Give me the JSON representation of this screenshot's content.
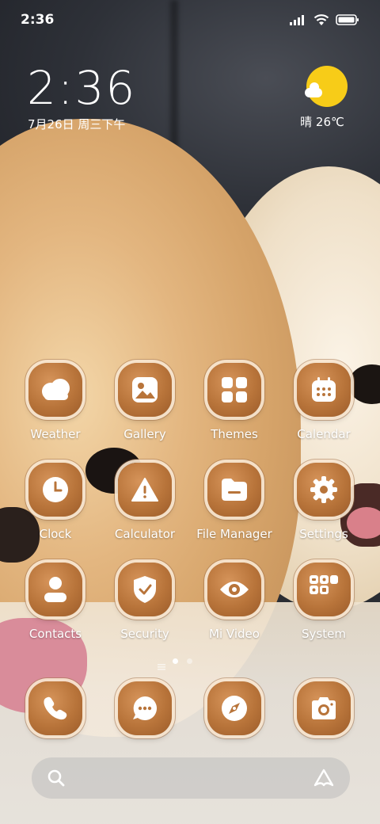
{
  "status_bar": {
    "time": "2:36",
    "signal_icon": "signal-bars-icon",
    "wifi_icon": "wifi-icon",
    "battery_icon": "battery-icon"
  },
  "clock_widget": {
    "time": "2:36",
    "date": "7月26日 周三下午"
  },
  "weather_widget": {
    "icon": "sun-cloud-icon",
    "text": "晴 26℃",
    "color_sun": "#f7cc18"
  },
  "apps": [
    {
      "label": "Weather",
      "icon": "weather-icon"
    },
    {
      "label": "Gallery",
      "icon": "gallery-icon"
    },
    {
      "label": "Themes",
      "icon": "themes-icon"
    },
    {
      "label": "Calendar",
      "icon": "calendar-icon"
    },
    {
      "label": "Clock",
      "icon": "clock-icon"
    },
    {
      "label": "Calculator",
      "icon": "calculator-icon"
    },
    {
      "label": "File Manager",
      "icon": "file-manager-icon"
    },
    {
      "label": "Settings",
      "icon": "settings-icon"
    },
    {
      "label": "Contacts",
      "icon": "contacts-icon"
    },
    {
      "label": "Security",
      "icon": "security-icon"
    },
    {
      "label": "Mi Video",
      "icon": "mi-video-icon"
    },
    {
      "label": "System",
      "icon": "system-folder-icon"
    }
  ],
  "page_indicator": {
    "pages": 2,
    "current": 1
  },
  "dock": [
    {
      "icon": "phone-icon"
    },
    {
      "icon": "messages-icon"
    },
    {
      "icon": "browser-icon"
    },
    {
      "icon": "camera-icon"
    }
  ],
  "search_bar": {
    "search_icon": "search-icon",
    "assistant_icon": "assistant-icon"
  },
  "colors": {
    "icon_tile": "#b8743a",
    "icon_glyph": "#ffffff"
  }
}
